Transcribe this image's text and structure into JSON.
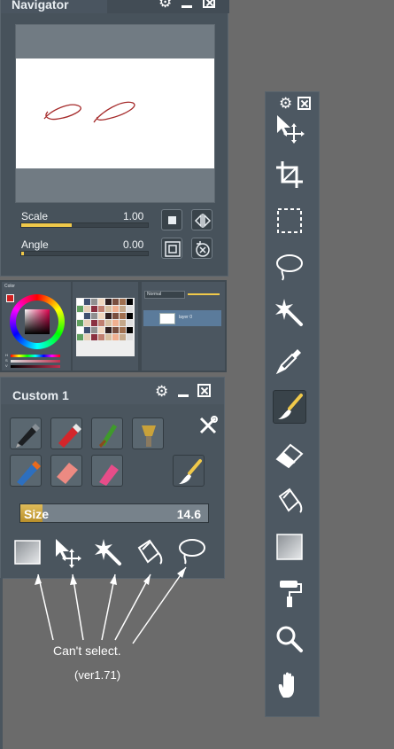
{
  "navigator": {
    "title": "Navigator",
    "scale_label": "Scale",
    "scale_value": "1.00",
    "angle_label": "Angle",
    "angle_value": "0.00"
  },
  "strip_panels": {
    "color_title": "Color",
    "color_readouts": [
      "H",
      "S",
      "V"
    ],
    "layer_blend": "Normal",
    "layer_name": "layer 0"
  },
  "custom_panel": {
    "title": "Custom 1",
    "size_label": "Size",
    "size_value": "14.6",
    "size_level": 0.12
  },
  "navigator_levels": {
    "scale_level": 0.4,
    "angle_level": 0.0
  },
  "annotation": {
    "text": "Can't select.",
    "version": "(ver1.71)"
  },
  "colors": {
    "accent": "#f0c94a",
    "panel": "#47525b",
    "background": "#6b6b6b"
  }
}
